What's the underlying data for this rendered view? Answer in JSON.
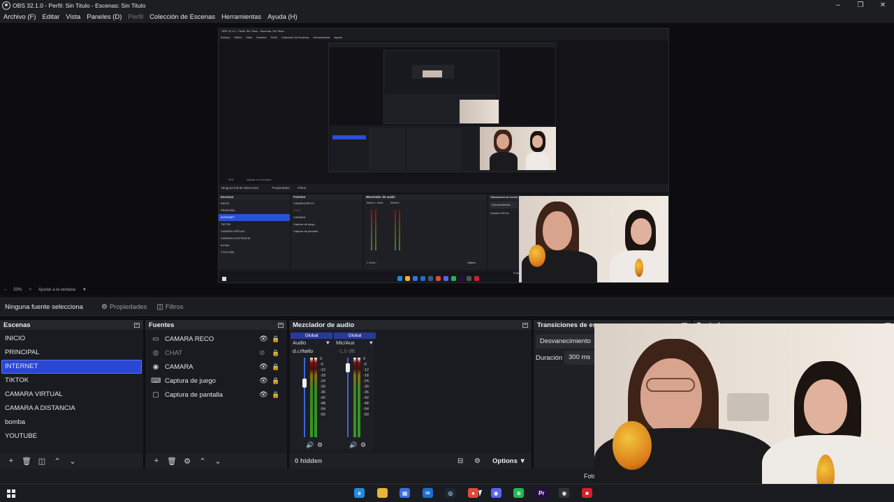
{
  "window": {
    "title": "OBS 32.1.0 - Perfil: Sin Titulo - Escenas: Sin Titulo",
    "controls": [
      "–",
      "❐",
      "✕"
    ]
  },
  "menu": [
    {
      "label": "Archivo (F)",
      "disabled": false
    },
    {
      "label": "Editar",
      "disabled": false
    },
    {
      "label": "Vista",
      "disabled": false
    },
    {
      "label": "Paneles (D)",
      "disabled": false
    },
    {
      "label": "Perfil",
      "disabled": true
    },
    {
      "label": "Colección de Escenas",
      "disabled": false
    },
    {
      "label": "Herramientas",
      "disabled": false
    },
    {
      "label": "Ayuda (H)",
      "disabled": false
    }
  ],
  "zoom": {
    "minus": "–",
    "value": "50%",
    "plus": "+",
    "fit": "Ajustar a la ventana"
  },
  "properties_bar": {
    "no_source": "Ninguna fuente selecciona",
    "properties": "Propiedades",
    "filters": "Filtros"
  },
  "scenes": {
    "title": "Escenas",
    "items": [
      "INICIO",
      "PRINCIPAL",
      "INTERNET",
      "TIKTOK",
      "CAMARA VIRTUAL",
      "CAMARA A DISTANCIA",
      "bomba",
      "YOUTUBE"
    ],
    "selected": "INTERNET"
  },
  "sources": {
    "title": "Fuentes",
    "items": [
      {
        "label": "CAMARA RECO",
        "icon": "display-icon",
        "visible": true
      },
      {
        "label": "CHAT",
        "icon": "browser-icon",
        "visible": false
      },
      {
        "label": "CAMARA",
        "icon": "camera-icon",
        "visible": true
      },
      {
        "label": "Captura de juego",
        "icon": "gamepad-icon",
        "visible": true
      },
      {
        "label": "Captura de pantalla",
        "icon": "monitor-icon",
        "visible": true
      }
    ]
  },
  "mixer": {
    "title": "Mezclador de audio",
    "channels": [
      {
        "global": "Global",
        "name": "Audio d...ritorio",
        "db": "-4.7 dB",
        "level": 0.9
      },
      {
        "global": "Global",
        "name": "Mic/Aux",
        "db": "-1.0 dB",
        "level": 0.9
      }
    ],
    "scale": [
      "0",
      "-6",
      "-12",
      "-18",
      "-24",
      "-30",
      "-36",
      "-42",
      "-48",
      "-54",
      "-60"
    ],
    "hidden": "0 hidden",
    "options": "Options"
  },
  "transitions": {
    "title": "Transiciones de escena",
    "type": "Desvanecimiento",
    "duration_label": "Duración",
    "duration_value": "300 ms"
  },
  "controls": {
    "title": "Controles"
  },
  "status": {
    "foto": "Foto"
  },
  "nested_preview": {
    "title": "OBS 32.1.0 - Perfil: Sin Titulo - Escenas: Sin Titulo",
    "menu": [
      "Archivo",
      "Editar",
      "Vista",
      "Paneles",
      "Perfil",
      "Colección de Escenas",
      "Herramientas",
      "Ayuda"
    ],
    "no_source": "Ninguna fuente selecciona",
    "props": "Propiedades",
    "filters": "Filtros",
    "scenes_title": "Escenas",
    "scenes": [
      "INICIO",
      "PRINCIPAL",
      "INTERNET",
      "TIKTOK",
      "CAMARA VIRTUAL",
      "CAMARA A DISTANCIA",
      "bomba",
      "YOUTUBE"
    ],
    "sources_title": "Fuentes",
    "sources": [
      "CAMARA RECO",
      "CHAT",
      "CAMARA",
      "Captura de juego",
      "Captura de pantalla"
    ],
    "mixer_title": "Mezclador de audio",
    "mixer_channels": [
      "Audio d...ritorio",
      "Mic/Aux"
    ],
    "mixer_hidden": "0 hidden",
    "mixer_options": "Options",
    "transitions_title": "Transiciones de escena",
    "transition": "Desvanecimiento",
    "duration_label": "Duración",
    "duration": "300 ms",
    "foto": "Foto",
    "zoom": "50%",
    "fit": "Ajustar a la ventana"
  },
  "taskbar": {
    "apps": [
      {
        "name": "edge-icon",
        "color": "#1f8be0",
        "glyph": "e"
      },
      {
        "name": "file-explorer-icon",
        "color": "#e8b33a",
        "glyph": ""
      },
      {
        "name": "microsoft-store-icon",
        "color": "#3a6fe0",
        "glyph": "▦"
      },
      {
        "name": "outlook-icon",
        "color": "#1a6fd0",
        "glyph": "✉"
      },
      {
        "name": "steam-icon",
        "color": "#1b2838",
        "glyph": "◎"
      },
      {
        "name": "chrome-icon",
        "color": "#e04a3a",
        "glyph": "●"
      },
      {
        "name": "discord-icon",
        "color": "#5865f2",
        "glyph": "◉"
      },
      {
        "name": "spotify-icon",
        "color": "#1db954",
        "glyph": "≋"
      },
      {
        "name": "premiere-icon",
        "color": "#2a0a4a",
        "glyph": "Pr"
      },
      {
        "name": "obs-icon",
        "color": "#333",
        "glyph": "◉"
      },
      {
        "name": "recording-app-icon",
        "color": "#d81e2a",
        "glyph": "■"
      }
    ]
  }
}
